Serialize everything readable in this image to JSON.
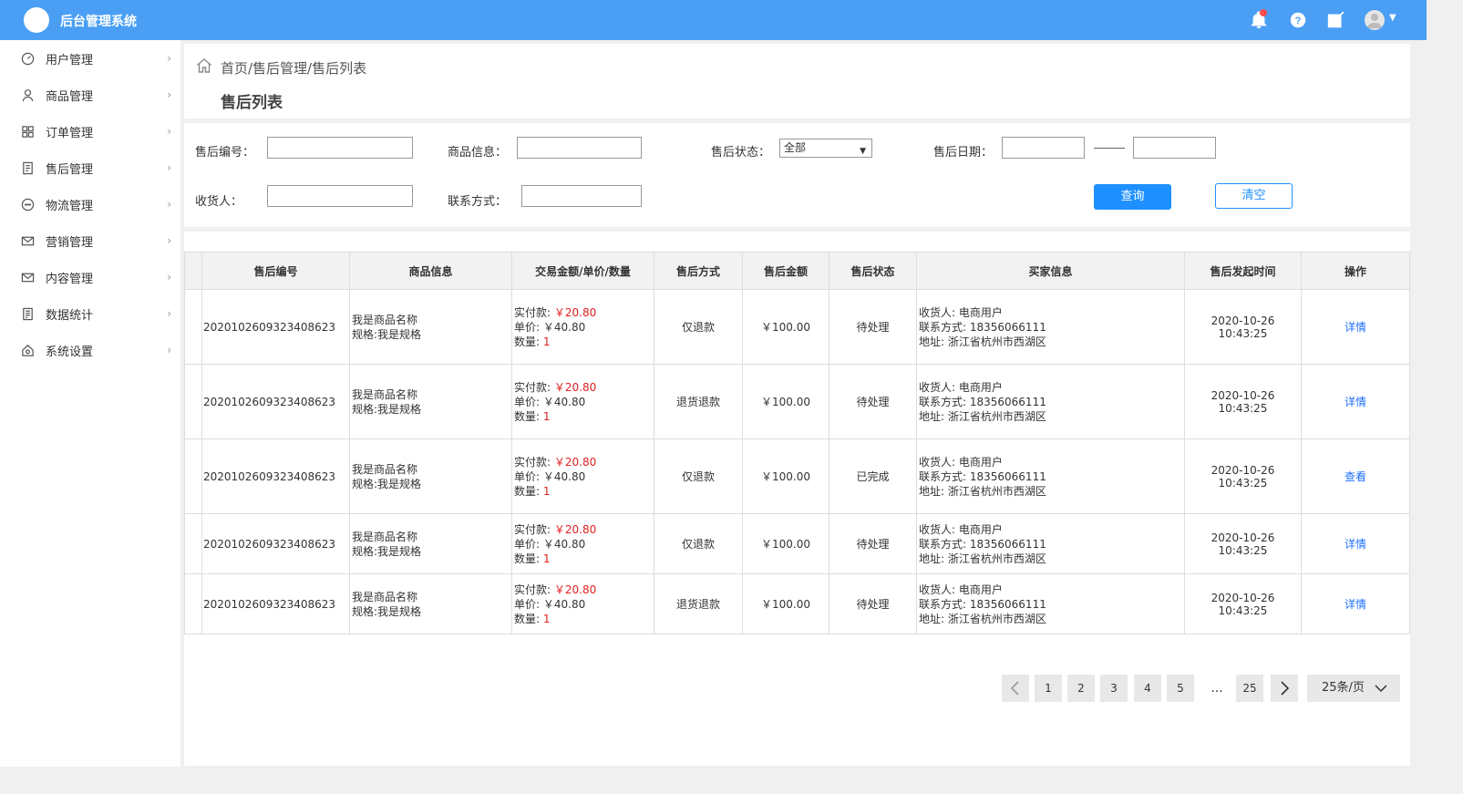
{
  "app": {
    "title": "后台管理系统"
  },
  "header": {
    "icons": [
      "bell-icon",
      "help-icon",
      "edit-icon",
      "avatar"
    ],
    "accent_color": "#4a9ff5"
  },
  "sidebar": {
    "items": [
      {
        "label": "用户管理",
        "icon": "dashboard-icon"
      },
      {
        "label": "商品管理",
        "icon": "user-icon"
      },
      {
        "label": "订单管理",
        "icon": "grid-icon"
      },
      {
        "label": "售后管理",
        "icon": "document-icon"
      },
      {
        "label": "物流管理",
        "icon": "chat-icon"
      },
      {
        "label": "营销管理",
        "icon": "mail-icon"
      },
      {
        "label": "内容管理",
        "icon": "mail-icon"
      },
      {
        "label": "数据统计",
        "icon": "report-icon"
      },
      {
        "label": "系统设置",
        "icon": "home-gear-icon"
      }
    ]
  },
  "breadcrumb": {
    "text": "首页/售后管理/售后列表"
  },
  "page": {
    "title": "售后列表"
  },
  "filters": {
    "after_sale_no_label": "售后编号：",
    "goods_info_label": "商品信息：",
    "status_label": "售后状态：",
    "status_value": "全部",
    "date_label": "售后日期：",
    "receiver_label": "收货人：",
    "contact_label": "联系方式：",
    "query_button": "查询",
    "clear_button": "清空"
  },
  "table": {
    "headers": [
      "售后编号",
      "商品信息",
      "交易金额/单价/数量",
      "售后方式",
      "售后金额",
      "售后状态",
      "买家信息",
      "售后发起时间",
      "操作"
    ],
    "rows": [
      {
        "id": "2020102609323408623",
        "goods_name": "我是商品名称",
        "goods_spec": "规格:我是规格",
        "paid_label": "实付款:",
        "paid": "￥20.80",
        "unit_label": "单价:",
        "unit": "￥40.80",
        "qty_label": "数量:",
        "qty": "1",
        "method": "仅退款",
        "amount": "￥100.00",
        "status": "待处理",
        "receiver": "收货人: 电商用户",
        "contact": "联系方式: 18356066111",
        "address": "地址: 浙江省杭州市西湖区",
        "time": "2020-10-26 10:43:25",
        "action": "详情"
      },
      {
        "id": "2020102609323408623",
        "goods_name": "我是商品名称",
        "goods_spec": "规格:我是规格",
        "paid_label": "实付款:",
        "paid": "￥20.80",
        "unit_label": "单价:",
        "unit": "￥40.80",
        "qty_label": "数量:",
        "qty": "1",
        "method": "退货退款",
        "amount": "￥100.00",
        "status": "待处理",
        "receiver": "收货人: 电商用户",
        "contact": "联系方式: 18356066111",
        "address": "地址: 浙江省杭州市西湖区",
        "time": "2020-10-26 10:43:25",
        "action": "详情"
      },
      {
        "id": "2020102609323408623",
        "goods_name": "我是商品名称",
        "goods_spec": "规格:我是规格",
        "paid_label": "实付款:",
        "paid": "￥20.80",
        "unit_label": "单价:",
        "unit": "￥40.80",
        "qty_label": "数量:",
        "qty": "1",
        "method": "仅退款",
        "amount": "￥100.00",
        "status": "已完成",
        "receiver": "收货人: 电商用户",
        "contact": "联系方式: 18356066111",
        "address": "地址: 浙江省杭州市西湖区",
        "time": "2020-10-26 10:43:25",
        "action": "查看"
      },
      {
        "id": "2020102609323408623",
        "goods_name": "我是商品名称",
        "goods_spec": "规格:我是规格",
        "paid_label": "实付款:",
        "paid": "￥20.80",
        "unit_label": "单价:",
        "unit": "￥40.80",
        "qty_label": "数量:",
        "qty": "1",
        "method": "仅退款",
        "amount": "￥100.00",
        "status": "待处理",
        "receiver": "收货人: 电商用户",
        "contact": "联系方式: 18356066111",
        "address": "地址: 浙江省杭州市西湖区",
        "time": "2020-10-26 10:43:25",
        "action": "详情"
      },
      {
        "id": "2020102609323408623",
        "goods_name": "我是商品名称",
        "goods_spec": "规格:我是规格",
        "paid_label": "实付款:",
        "paid": "￥20.80",
        "unit_label": "单价:",
        "unit": "￥40.80",
        "qty_label": "数量:",
        "qty": "1",
        "method": "退货退款",
        "amount": "￥100.00",
        "status": "待处理",
        "receiver": "收货人: 电商用户",
        "contact": "联系方式: 18356066111",
        "address": "地址: 浙江省杭州市西湖区",
        "time": "2020-10-26 10:43:25",
        "action": "详情"
      }
    ]
  },
  "pagination": {
    "pages": [
      "1",
      "2",
      "3",
      "4",
      "5"
    ],
    "ellipsis": "...",
    "last_page": "25",
    "page_size": "25条/页"
  }
}
